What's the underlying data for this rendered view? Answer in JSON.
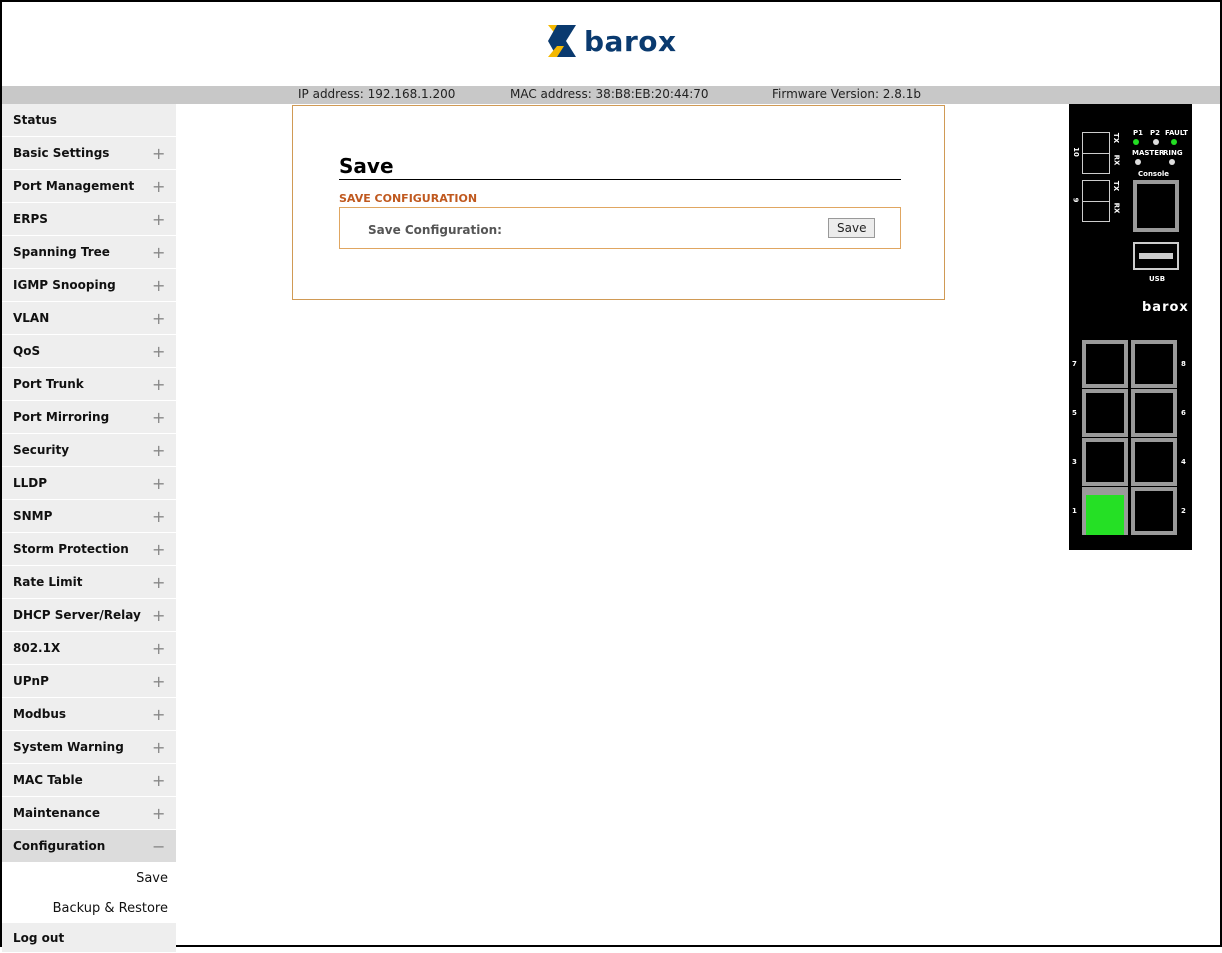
{
  "brand": {
    "logo_text": "barox"
  },
  "info_bar": {
    "ip": "IP address: 192.168.1.200",
    "mac": "MAC address: 38:B8:EB:20:44:70",
    "firmware": "Firmware Version: 2.8.1b"
  },
  "sidebar": {
    "items": [
      {
        "label": "Status",
        "toggle": ""
      },
      {
        "label": "Basic Settings",
        "toggle": "+"
      },
      {
        "label": "Port Management",
        "toggle": "+"
      },
      {
        "label": "ERPS",
        "toggle": "+"
      },
      {
        "label": "Spanning Tree",
        "toggle": "+"
      },
      {
        "label": "IGMP Snooping",
        "toggle": "+"
      },
      {
        "label": "VLAN",
        "toggle": "+"
      },
      {
        "label": "QoS",
        "toggle": "+"
      },
      {
        "label": "Port Trunk",
        "toggle": "+"
      },
      {
        "label": "Port Mirroring",
        "toggle": "+"
      },
      {
        "label": "Security",
        "toggle": "+"
      },
      {
        "label": "LLDP",
        "toggle": "+"
      },
      {
        "label": "SNMP",
        "toggle": "+"
      },
      {
        "label": "Storm Protection",
        "toggle": "+"
      },
      {
        "label": "Rate Limit",
        "toggle": "+"
      },
      {
        "label": "DHCP Server/Relay",
        "toggle": "+"
      },
      {
        "label": "802.1X",
        "toggle": "+"
      },
      {
        "label": "UPnP",
        "toggle": "+"
      },
      {
        "label": "Modbus",
        "toggle": "+"
      },
      {
        "label": "System Warning",
        "toggle": "+"
      },
      {
        "label": "MAC Table",
        "toggle": "+"
      },
      {
        "label": "Maintenance",
        "toggle": "+"
      },
      {
        "label": "Configuration",
        "toggle": "−"
      }
    ],
    "sub_items": [
      "Save",
      "Backup & Restore"
    ],
    "logout": "Log out"
  },
  "main": {
    "title": "Save",
    "section_heading": "SAVE CONFIGURATION",
    "field_label": "Save Configuration:",
    "button_label": "Save"
  },
  "device": {
    "led_labels": [
      "P1",
      "P2",
      "FAULT",
      "MASTER",
      "RING"
    ],
    "led_colors": {
      "P1": "#22dd22",
      "P2": "#dddddd",
      "FAULT": "#22dd22",
      "MASTER": "#dddddd",
      "RING": "#dddddd"
    },
    "sfp_ports": [
      "10",
      "9"
    ],
    "sfp_labels": [
      "TX",
      "RX"
    ],
    "console_label": "Console",
    "usb_label": "USB",
    "brand_text": "barox",
    "port_numbers": [
      "7",
      "8",
      "5",
      "6",
      "3",
      "4",
      "1",
      "2"
    ],
    "active_port": "1",
    "active_color": "#25e025"
  }
}
